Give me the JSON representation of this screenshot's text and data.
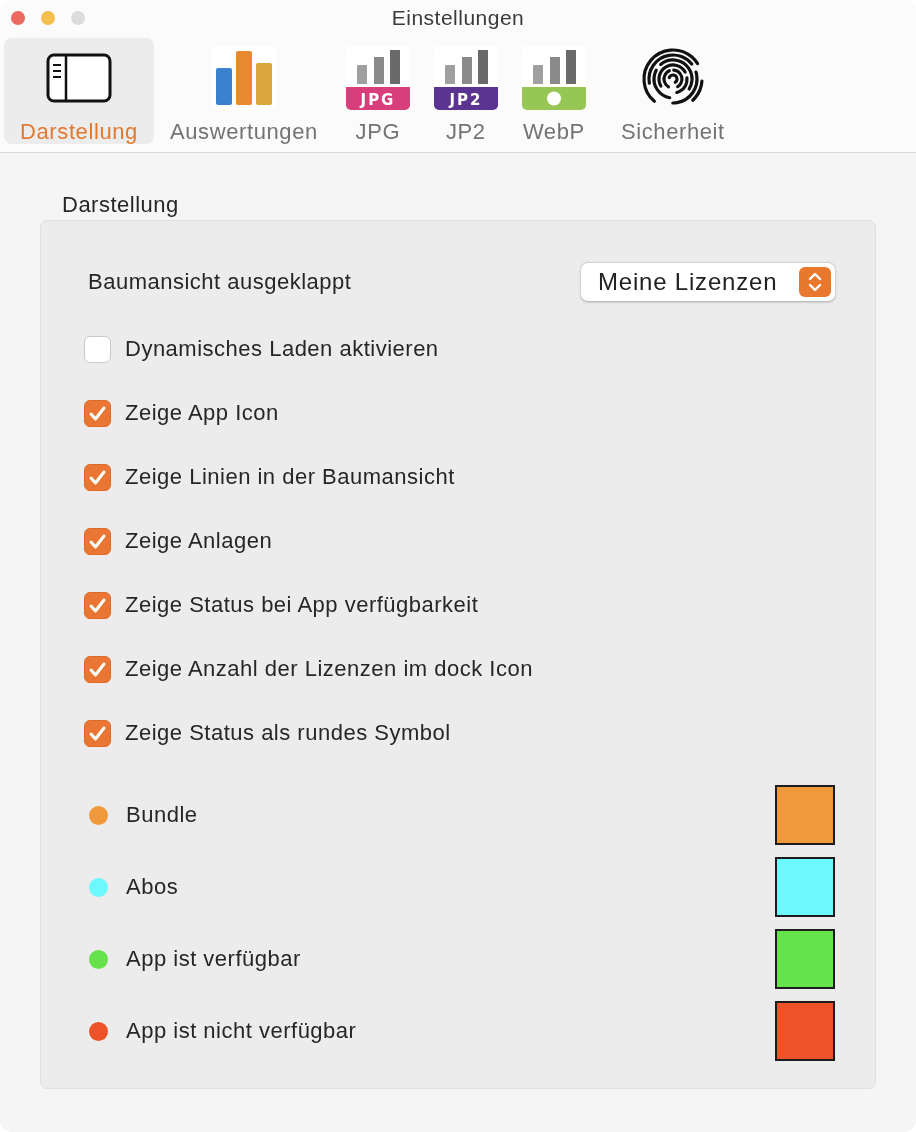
{
  "window": {
    "title": "Einstellungen",
    "buttons": [
      {
        "kind": "close",
        "disabled": false
      },
      {
        "kind": "minimize",
        "disabled": false
      },
      {
        "kind": "zoom",
        "disabled": true
      }
    ]
  },
  "toolbar": {
    "tabs": [
      {
        "label": "Darstellung",
        "kind": "panel",
        "selected": true
      },
      {
        "label": "Auswertungen",
        "kind": "chart",
        "selected": false
      },
      {
        "label": "JPG",
        "kind": "format",
        "badge": "JPG",
        "color": "#d83d7c",
        "selected": false
      },
      {
        "label": "JP2",
        "kind": "format",
        "badge": "JP2",
        "color": "#5b3390",
        "selected": false
      },
      {
        "label": "WebP",
        "kind": "format",
        "color": "#96c653",
        "selected": false
      },
      {
        "label": "Sicherheit",
        "kind": "fingerprint",
        "selected": false
      }
    ]
  },
  "group": {
    "title": "Darstellung",
    "popup": {
      "label": "Baumansicht ausgeklappt",
      "value": "Meine Lizenzen"
    },
    "options": [
      {
        "label": "Dynamisches Laden aktivieren",
        "checked": false
      },
      {
        "label": "Zeige App Icon",
        "checked": true
      },
      {
        "label": "Zeige Linien in der Baumansicht",
        "checked": true
      },
      {
        "label": "Zeige Anlagen",
        "checked": true
      },
      {
        "label": "Zeige Status bei App verfügbarkeit",
        "checked": true
      },
      {
        "label": "Zeige Anzahl der Lizenzen im dock Icon",
        "checked": true
      },
      {
        "label": "Zeige Status als rundes Symbol",
        "checked": true
      }
    ],
    "legend": [
      {
        "label": "Bundle",
        "color": "#f0993a"
      },
      {
        "label": "Abos",
        "color": "#6cf8fc"
      },
      {
        "label": "App ist verfügbar",
        "color": "#66e34a"
      },
      {
        "label": "App ist nicht verfügbar",
        "color": "#ee5228"
      }
    ]
  }
}
